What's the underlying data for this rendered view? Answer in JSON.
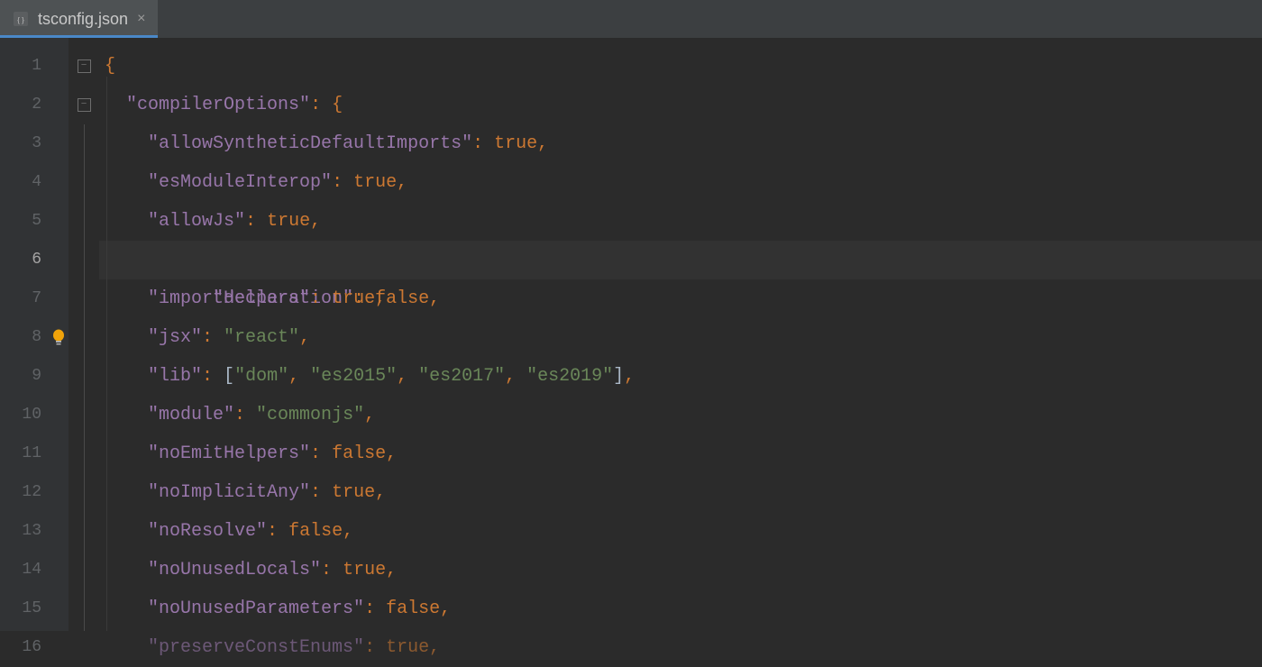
{
  "tab": {
    "filename": "tsconfig.json",
    "close_glyph": "×"
  },
  "editor": {
    "active_line": 6,
    "line_count": 16
  },
  "code": {
    "l1": {
      "brace": "{"
    },
    "l2": {
      "key": "\"compilerOptions\"",
      "sep": ": ",
      "brace": "{"
    },
    "l3": {
      "key": "\"allowSyntheticDefaultImports\"",
      "sep": ": ",
      "val": "true",
      "comma": ","
    },
    "l4": {
      "key": "\"esModuleInterop\"",
      "sep": ": ",
      "val": "true",
      "comma": ","
    },
    "l5": {
      "key": "\"allowJs\"",
      "sep": ": ",
      "val": "true",
      "comma": ","
    },
    "l6": {
      "key": "\"declaration\"",
      "sep": ": ",
      "val": "false",
      "comma": ","
    },
    "l7": {
      "key": "\"importHelpers\"",
      "sep": ": ",
      "val": "true",
      "comma": ","
    },
    "l8": {
      "key": "\"jsx\"",
      "sep": ": ",
      "val": "\"react\"",
      "comma": ","
    },
    "l9": {
      "key": "\"lib\"",
      "sep": ": ",
      "lb": "[",
      "v1": "\"dom\"",
      "c1": ", ",
      "v2": "\"es2015\"",
      "c2": ", ",
      "v3": "\"es2017\"",
      "c3": ", ",
      "v4": "\"es2019\"",
      "rb": "]",
      "comma": ","
    },
    "l10": {
      "key": "\"module\"",
      "sep": ": ",
      "val": "\"commonjs\"",
      "comma": ","
    },
    "l11": {
      "key": "\"noEmitHelpers\"",
      "sep": ": ",
      "val": "false",
      "comma": ","
    },
    "l12": {
      "key": "\"noImplicitAny\"",
      "sep": ": ",
      "val": "true",
      "comma": ","
    },
    "l13": {
      "key": "\"noResolve\"",
      "sep": ": ",
      "val": "false",
      "comma": ","
    },
    "l14": {
      "key": "\"noUnusedLocals\"",
      "sep": ": ",
      "val": "true",
      "comma": ","
    },
    "l15": {
      "key": "\"noUnusedParameters\"",
      "sep": ": ",
      "val": "false",
      "comma": ","
    },
    "l16": {
      "key": "\"preserveConstEnums\"",
      "sep": ": ",
      "val": "true",
      "comma": ","
    }
  }
}
